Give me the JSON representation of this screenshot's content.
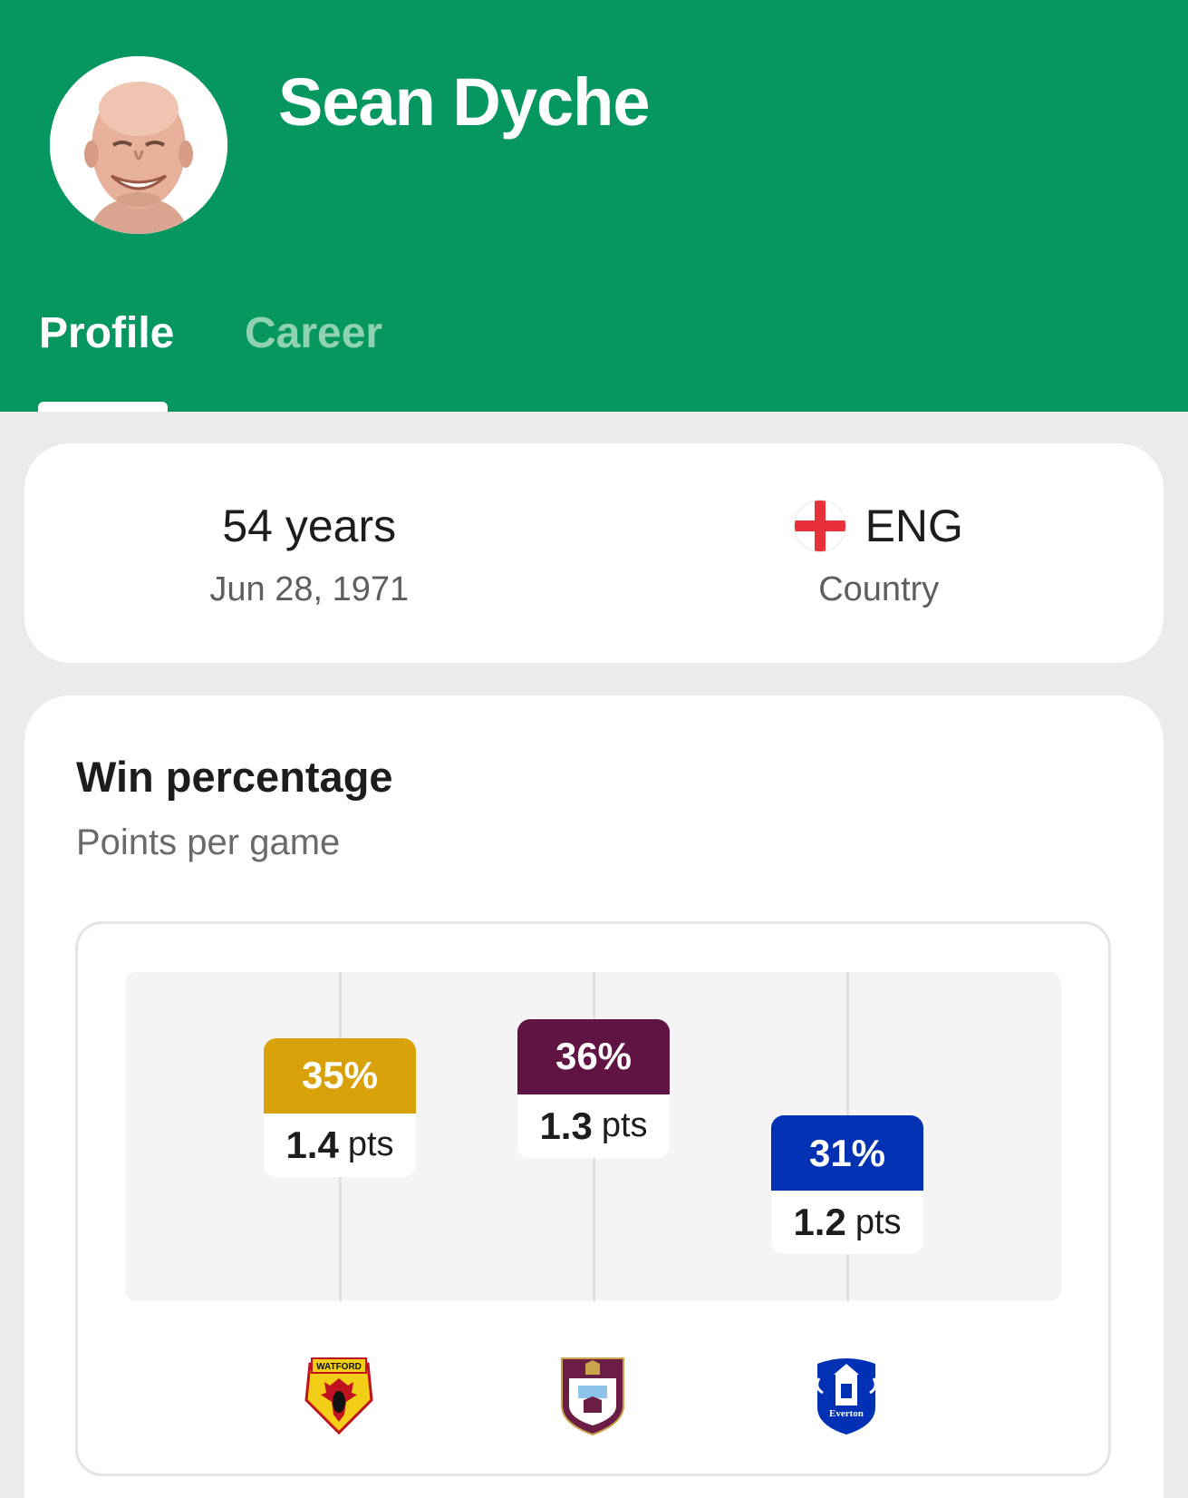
{
  "header": {
    "name": "Sean Dyche",
    "tabs": [
      {
        "label": "Profile",
        "active": true
      },
      {
        "label": "Career",
        "active": false
      }
    ],
    "color": "#069760"
  },
  "info": {
    "age": "54 years",
    "birth_date": "Jun 28, 1971",
    "country_code": "ENG",
    "country_label": "Country",
    "flag_icon": "england-flag-icon"
  },
  "win_card": {
    "title": "Win percentage",
    "subtitle": "Points per game"
  },
  "chart_data": {
    "type": "scatter",
    "categories": [
      "Watford",
      "Burnley",
      "Everton"
    ],
    "win_percentage": [
      35,
      36,
      31
    ],
    "points_per_game": [
      1.4,
      1.3,
      1.2
    ],
    "colors": [
      "#d8a10a",
      "#5f1443",
      "#0231b3"
    ],
    "badges": [
      {
        "team": "Watford",
        "win_label": "35%",
        "pts_value": "1.4",
        "pts_unit": "pts",
        "color": "#d8a10a",
        "crest_icon": "watford-crest-icon",
        "crest_text": "WATFORD"
      },
      {
        "team": "Burnley",
        "win_label": "36%",
        "pts_value": "1.3",
        "pts_unit": "pts",
        "color": "#5f1443",
        "crest_icon": "burnley-crest-icon"
      },
      {
        "team": "Everton",
        "win_label": "31%",
        "pts_value": "1.2",
        "pts_unit": "pts",
        "color": "#0231b3",
        "crest_icon": "everton-crest-icon",
        "crest_text": "Everton"
      }
    ]
  }
}
